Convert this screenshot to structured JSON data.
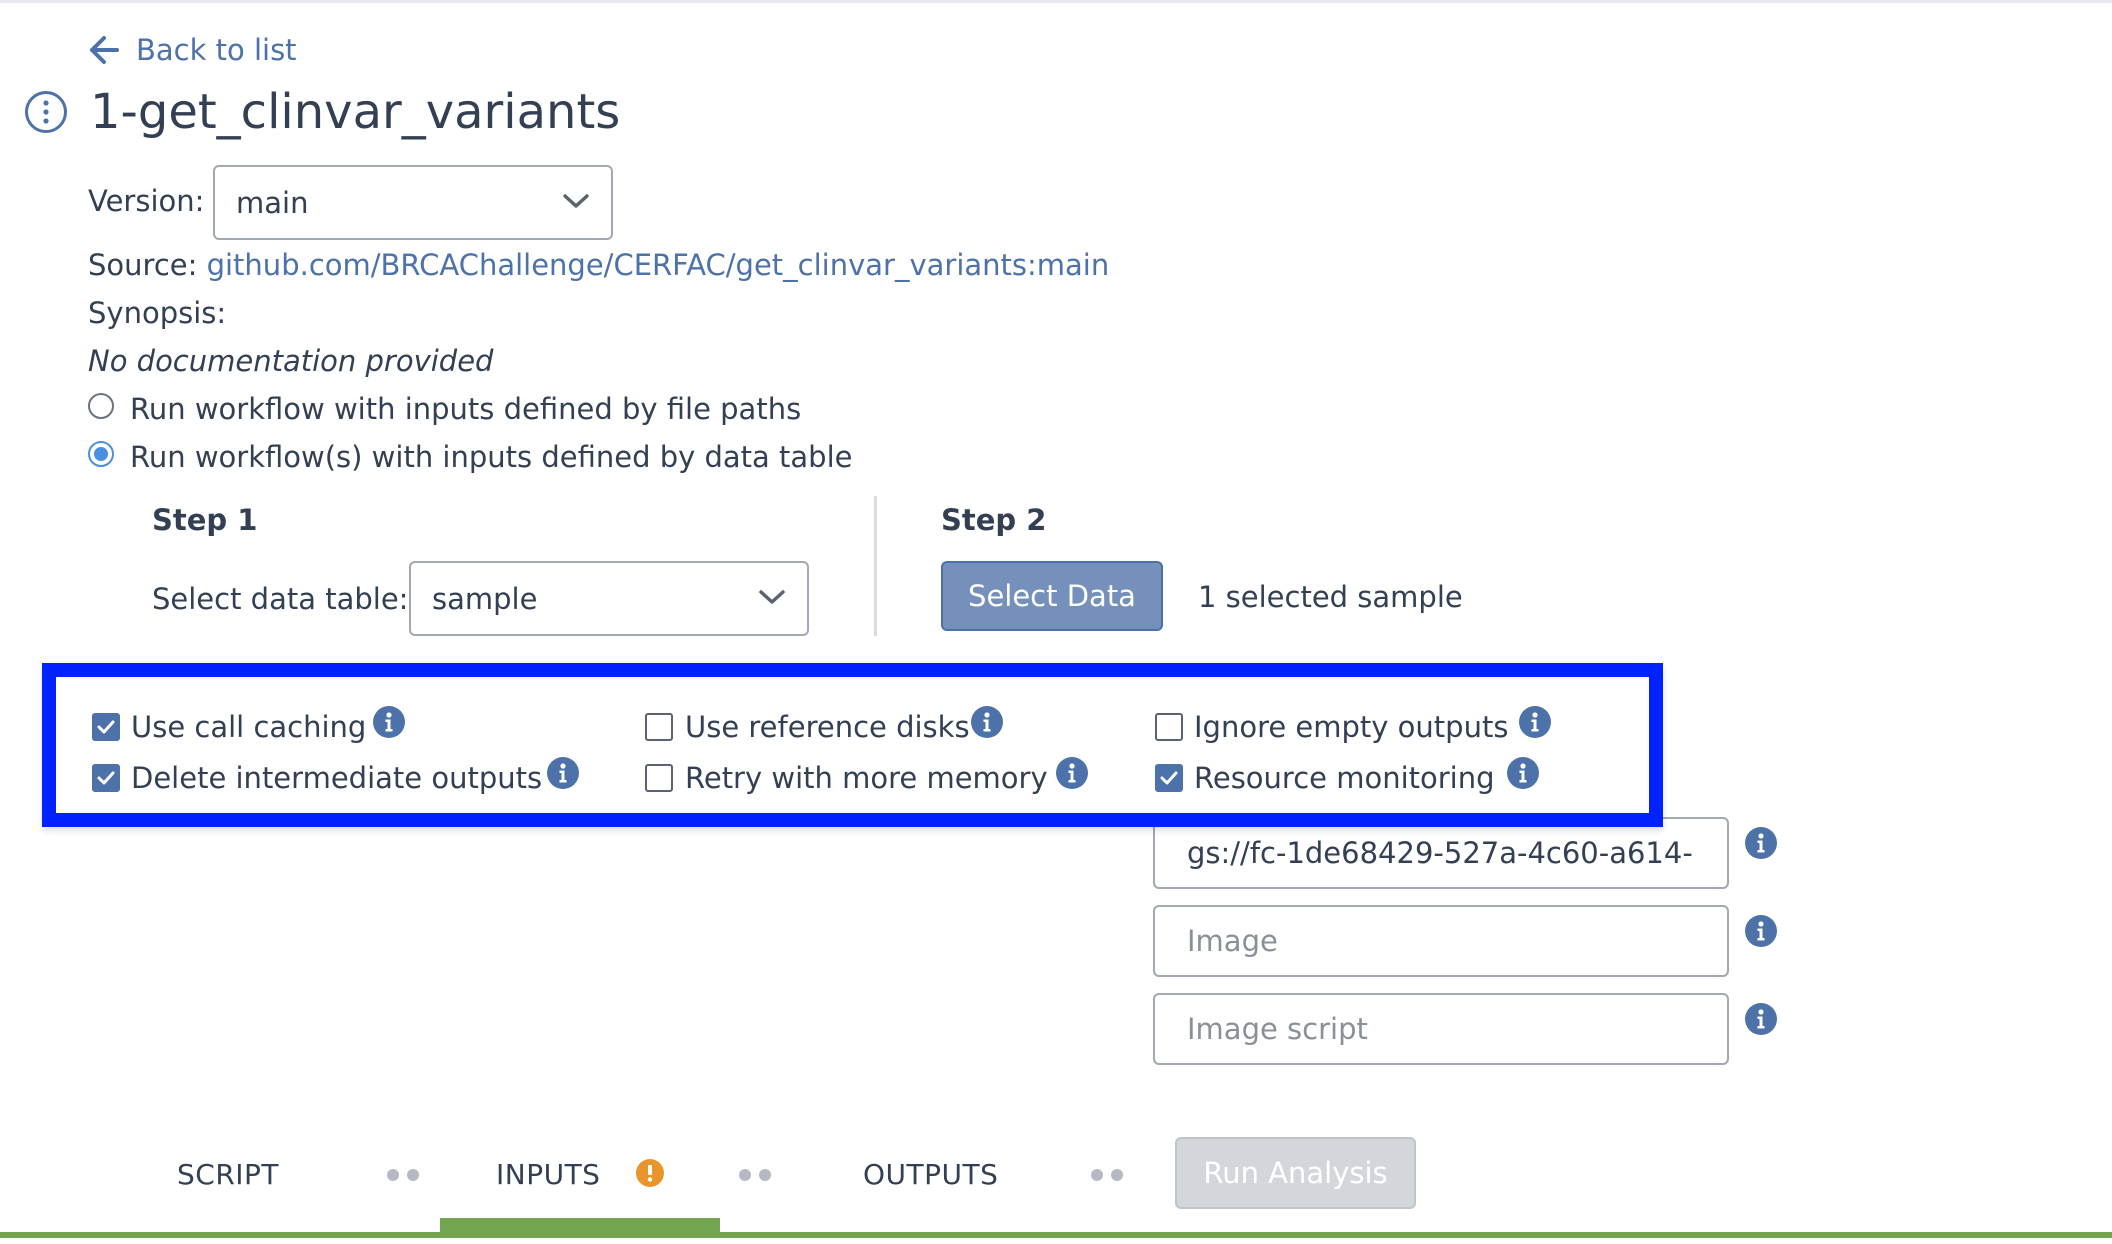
{
  "nav": {
    "back_label": "Back to list"
  },
  "workflow": {
    "title": "1-get_clinvar_variants"
  },
  "version": {
    "label": "Version:",
    "value": "main"
  },
  "source": {
    "label": "Source:",
    "link": "github.com/BRCAChallenge/CERFAC/get_clinvar_variants:main"
  },
  "synopsis": {
    "label": "Synopsis:",
    "text": "No documentation provided"
  },
  "run_mode": {
    "options": [
      {
        "label": "Run workflow with inputs defined by file paths",
        "selected": false
      },
      {
        "label": "Run workflow(s) with inputs defined by data table",
        "selected": true
      }
    ]
  },
  "step1": {
    "heading": "Step 1",
    "label": "Select data table:",
    "value": "sample"
  },
  "step2": {
    "heading": "Step 2",
    "button": "Select Data",
    "selection_text": "1 selected sample"
  },
  "options": [
    {
      "label": "Use call caching",
      "checked": true
    },
    {
      "label": "Use reference disks",
      "checked": false
    },
    {
      "label": "Ignore empty outputs",
      "checked": false
    },
    {
      "label": "Delete intermediate outputs",
      "checked": true
    },
    {
      "label": "Retry with more memory",
      "checked": false
    },
    {
      "label": "Resource monitoring",
      "checked": true
    }
  ],
  "fields": {
    "output_bucket": "gs://fc-1de68429-527a-4c60-a614-",
    "image_placeholder": "Image",
    "image_script_placeholder": "Image script"
  },
  "tabs": {
    "script": "SCRIPT",
    "inputs": "INPUTS",
    "outputs": "OUTPUTS",
    "run_button": "Run Analysis"
  },
  "colors": {
    "accent": "#4d72aa",
    "highlight_box": "#0022ff",
    "warning": "#e8962c",
    "active_tab": "#74a550"
  }
}
